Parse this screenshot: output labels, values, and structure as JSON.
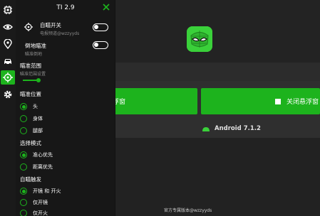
{
  "app": {
    "open_float_button": "浮窗",
    "close_float_button": "关闭悬浮窗",
    "android_version": "Android 7.1.2",
    "footer_text": "官方专属版本@wzzyyds"
  },
  "menu": {
    "title": "TI 2.9",
    "rail_icons": [
      "chip-icon",
      "eye-icon",
      "location-pin-icon",
      "car-icon",
      "crosshair-icon",
      "gear-icon"
    ],
    "settings": [
      {
        "title": "自瞄开关",
        "desc": "电报频道@wzzyyds",
        "toggle": false
      },
      {
        "title": "倒地瞄准",
        "desc": "瞄准倒地",
        "toggle": false
      },
      {
        "title": "瞄准范围",
        "desc": "瞄准范围设置"
      }
    ],
    "aim_position": {
      "title": "瞄准位置",
      "options": [
        {
          "label": "头",
          "selected": true
        },
        {
          "label": "身体",
          "selected": false
        },
        {
          "label": "腿部",
          "selected": false
        }
      ]
    },
    "select_mode": {
      "title": "选择模式",
      "options": [
        {
          "label": "准心优先",
          "selected": true
        },
        {
          "label": "距离优先",
          "selected": false
        }
      ]
    },
    "auto_trigger": {
      "title": "自瞄触发",
      "options": [
        {
          "label": "开镜 和 开火",
          "selected": true
        },
        {
          "label": "仅开镜",
          "selected": false
        },
        {
          "label": "仅开火",
          "selected": false
        }
      ]
    }
  },
  "colors": {
    "accent": "#1db31d",
    "panel_bg": "#171717",
    "app_bg": "#222222"
  }
}
